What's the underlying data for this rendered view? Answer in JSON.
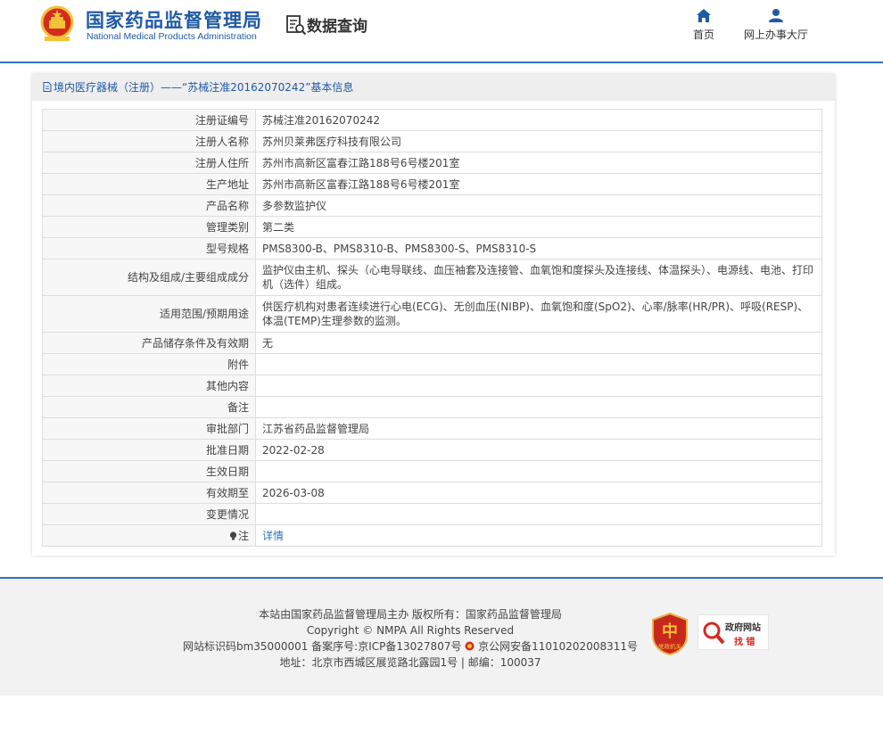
{
  "header": {
    "brand_cn": "国家药品监督管理局",
    "brand_en": "National Medical Products Administration",
    "query_title": "数据查询",
    "nav": [
      {
        "label": "首页",
        "icon": "home-icon"
      },
      {
        "label": "网上办事大厅",
        "icon": "user-icon"
      }
    ]
  },
  "content": {
    "heading": "境内医疗器械（注册）——“苏械注准20162070242”基本信息",
    "rows": [
      {
        "label": "注册证编号",
        "value": "苏械注准20162070242"
      },
      {
        "label": "注册人名称",
        "value": "苏州贝莱弗医疗科技有限公司"
      },
      {
        "label": "注册人住所",
        "value": "苏州市高新区富春江路188号6号楼201室"
      },
      {
        "label": "生产地址",
        "value": "苏州市高新区富春江路188号6号楼201室"
      },
      {
        "label": "产品名称",
        "value": "多参数监护仪"
      },
      {
        "label": "管理类别",
        "value": "第二类"
      },
      {
        "label": "型号规格",
        "value": "PMS8300-B、PMS8310-B、PMS8300-S、PMS8310-S"
      },
      {
        "label": "结构及组成/主要组成成分",
        "value": "监护仪由主机、探头（心电导联线、血压袖套及连接管、血氧饱和度探头及连接线、体温探头）、电源线、电池、打印机（选件）组成。"
      },
      {
        "label": "适用范围/预期用途",
        "value": "供医疗机构对患者连续进行心电(ECG)、无创血压(NIBP)、血氧饱和度(SpO2)、心率/脉率(HR/PR)、呼吸(RESP)、体温(TEMP)生理参数的监测。"
      },
      {
        "label": "产品储存条件及有效期",
        "value": "无"
      },
      {
        "label": "附件",
        "value": ""
      },
      {
        "label": "其他内容",
        "value": ""
      },
      {
        "label": "备注",
        "value": ""
      },
      {
        "label": "审批部门",
        "value": "江苏省药品监督管理局"
      },
      {
        "label": "批准日期",
        "value": "2022-02-28"
      },
      {
        "label": "生效日期",
        "value": ""
      },
      {
        "label": "有效期至",
        "value": "2026-03-08"
      },
      {
        "label": "变更情况",
        "value": ""
      }
    ],
    "note_label": "注",
    "note_link": "详情"
  },
  "footer": {
    "line1": "本站由国家药品监督管理局主办 版权所有：国家药品监督管理局",
    "line2": "Copyright © NMPA All Rights Reserved",
    "line3a": "网站标识码bm35000001   备案序号:京ICP备13027807号  ",
    "line3b": "京公网安备11010202008311号",
    "line4": "地址：北京市西城区展览路北露园1号 | 邮编：100037",
    "badge_party": "党政机关",
    "badge_err_1": "政府网站",
    "badge_err_2": "找 错"
  },
  "colors": {
    "brand_blue": "#1f5aa6",
    "accent_blue": "#2f73b8",
    "emblem_red": "#d52b1e",
    "emblem_gold": "#f4c237"
  }
}
